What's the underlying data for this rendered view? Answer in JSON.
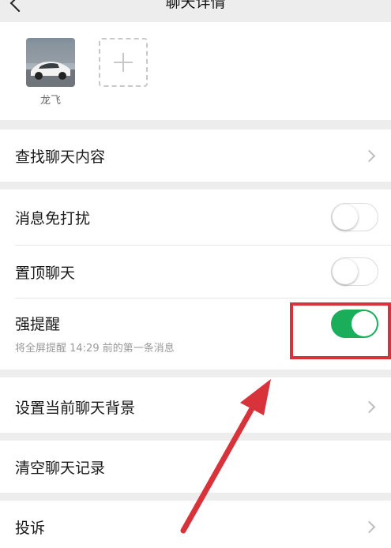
{
  "header": {
    "title": "聊天详情"
  },
  "members": {
    "items": [
      {
        "name": "龙飞"
      }
    ]
  },
  "search_history": {
    "label": "查找聊天内容"
  },
  "settings": {
    "mute": {
      "label": "消息免打扰",
      "on": false
    },
    "pin": {
      "label": "置顶聊天",
      "on": false
    },
    "strong_reminder": {
      "label": "强提醒",
      "subtitle": "将全屏提醒 14:29 前的第一条消息",
      "on": true
    }
  },
  "background": {
    "label": "设置当前聊天背景"
  },
  "clear": {
    "label": "清空聊天记录"
  },
  "report": {
    "label": "投诉"
  },
  "colors": {
    "toggle_on": "#1aad5a",
    "annotation": "#d8323b"
  }
}
